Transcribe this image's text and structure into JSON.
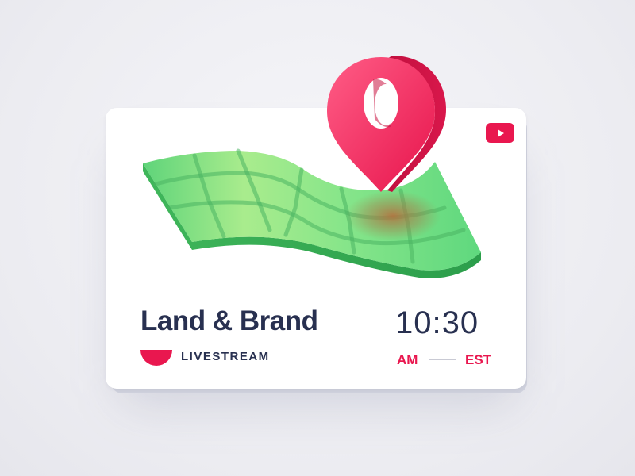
{
  "card": {
    "title": "Land & Brand",
    "live_label": "LIVESTREAM",
    "time": "10:30",
    "ampm": "AM",
    "timezone": "EST"
  },
  "icons": {
    "video": "youtube-play-icon",
    "pin": "map-pin-icon",
    "map": "folded-map-illustration",
    "live": "half-circle-live-icon"
  },
  "colors": {
    "accent": "#e9174f",
    "text": "#283050",
    "map_green": "#6fe07d",
    "map_edge": "#2fa84f"
  }
}
